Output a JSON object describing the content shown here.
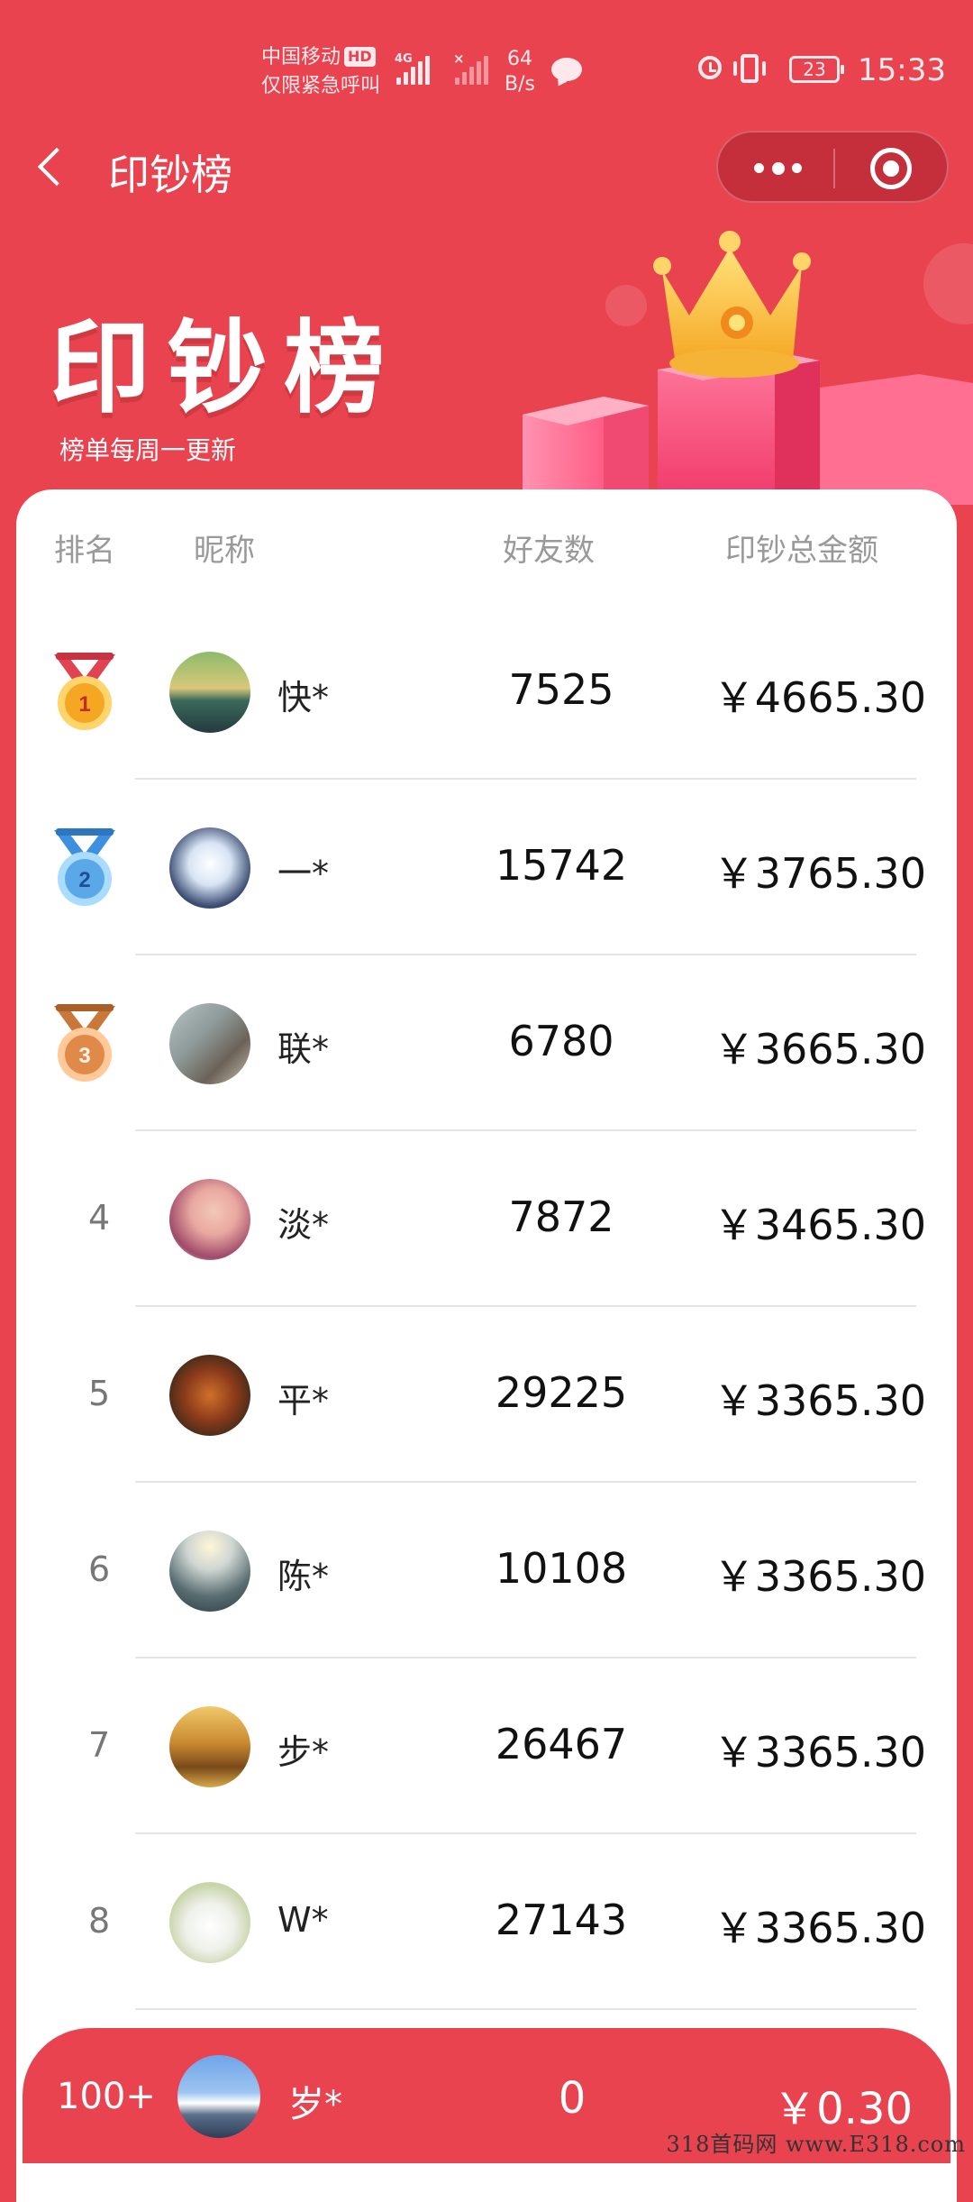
{
  "status_bar": {
    "carrier": "中国移动",
    "hd": "HD",
    "emergency": "仅限紧急呼叫",
    "net_type": "4G",
    "speed_value": "64",
    "speed_unit": "B/s",
    "battery": "23",
    "time": "15:33"
  },
  "nav": {
    "title": "印钞榜"
  },
  "banner": {
    "title": "印钞榜",
    "subtitle": "榜单每周一更新"
  },
  "table": {
    "headers": {
      "rank": "排名",
      "nickname": "昵称",
      "friends": "好友数",
      "amount": "印钞总金额"
    },
    "rows": [
      {
        "rank": "1",
        "nickname": "快*",
        "friends": "7525",
        "amount": "￥4665.30",
        "medal": "gold-medal"
      },
      {
        "rank": "2",
        "nickname": "一*",
        "friends": "15742",
        "amount": "￥3765.30",
        "medal": "silver-medal"
      },
      {
        "rank": "3",
        "nickname": "联*",
        "friends": "6780",
        "amount": "￥3665.30",
        "medal": "bronze-medal"
      },
      {
        "rank": "4",
        "nickname": "淡*",
        "friends": "7872",
        "amount": "￥3465.30"
      },
      {
        "rank": "5",
        "nickname": "平*",
        "friends": "29225",
        "amount": "￥3365.30"
      },
      {
        "rank": "6",
        "nickname": "陈*",
        "friends": "10108",
        "amount": "￥3365.30"
      },
      {
        "rank": "7",
        "nickname": "步*",
        "friends": "26467",
        "amount": "￥3365.30"
      },
      {
        "rank": "8",
        "nickname": "W*",
        "friends": "27143",
        "amount": "￥3365.30"
      }
    ]
  },
  "my_rank": {
    "rank": "100+",
    "nickname": "岁*",
    "friends": "0",
    "amount": "￥0.30"
  },
  "watermark": "318首码网 www.E318.com",
  "colors": {
    "brand_red": "#e94350",
    "gold": "#f5a623",
    "silver": "#5aa8e8",
    "bronze": "#e08a4a"
  }
}
